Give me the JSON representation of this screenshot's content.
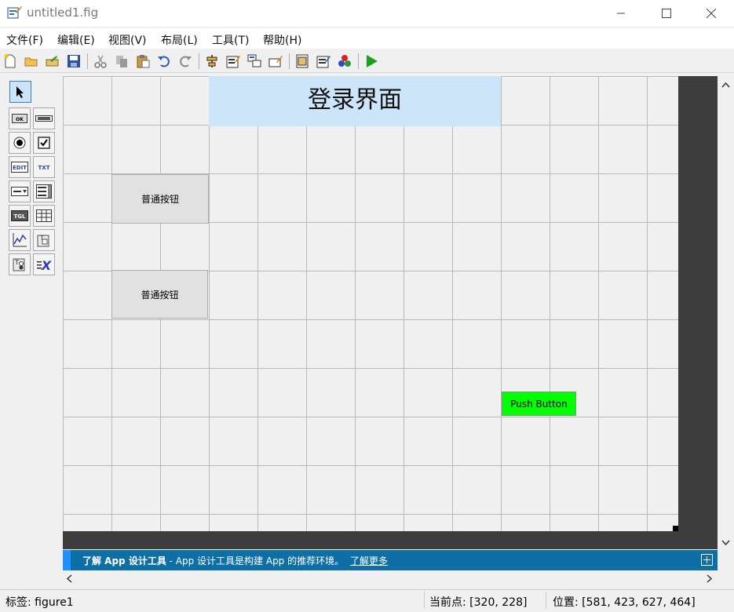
{
  "window": {
    "title": "untitled1.fig",
    "controls": [
      "minimize-icon",
      "maximize-icon",
      "close-icon"
    ]
  },
  "menu": [
    {
      "label": "文件(F)"
    },
    {
      "label": "编辑(E)"
    },
    {
      "label": "视图(V)"
    },
    {
      "label": "布局(L)"
    },
    {
      "label": "工具(T)"
    },
    {
      "label": "帮助(H)"
    }
  ],
  "toolbar": {
    "icons": [
      "new-icon",
      "open-icon",
      "save-open-icon",
      "save-icon",
      "cut-icon",
      "copy-icon",
      "paste-icon",
      "undo-icon",
      "redo-icon",
      "align-icon",
      "menu-editor-icon",
      "tab-order-icon",
      "toolbar-editor-icon",
      "editor-icon",
      "property-inspector-icon",
      "object-browser-icon",
      "run-icon"
    ]
  },
  "palette": {
    "items": [
      "select-arrow-icon",
      "push-button-icon",
      "slider-icon",
      "radio-button-icon",
      "checkbox-icon",
      "edit-text-icon",
      "static-text-icon",
      "popup-menu-icon",
      "listbox-icon",
      "toggle-button-icon",
      "table-icon",
      "axes-icon",
      "panel-icon",
      "button-group-icon",
      "activex-icon"
    ]
  },
  "canvas": {
    "title_box_text": "登录界面",
    "button1_text": "普通按钮",
    "button2_text": "普通按钮",
    "green_button_text": "Push Button",
    "green_button_color": "#00ff00",
    "title_box_color": "#cce5f8"
  },
  "banner": {
    "bold_text": "了解 App 设计工具",
    "text": " - App 设计工具是构建 App 的推荐环境。",
    "link": "了解更多"
  },
  "status": {
    "tag": "标签: figure1",
    "current_point": "当前点:  [320, 228]",
    "position": "位置: [581, 423, 627, 464]"
  }
}
